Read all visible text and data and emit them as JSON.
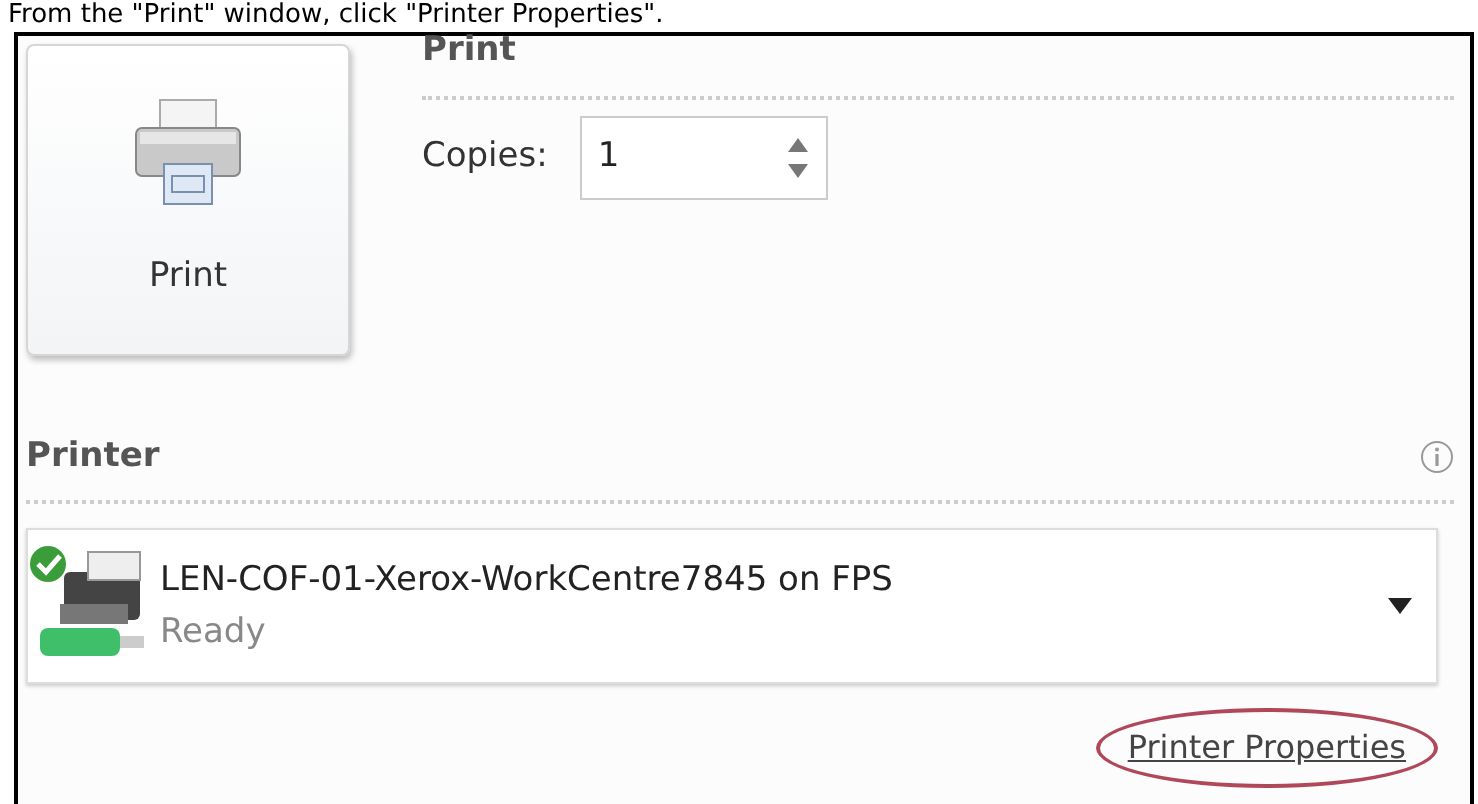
{
  "instruction": "From the \"Print\" window, click \"Printer Properties\".",
  "print_button": {
    "label": "Print"
  },
  "print_section": {
    "title": "Print",
    "copies_label": "Copies:",
    "copies_value": "1"
  },
  "printer_section": {
    "title": "Printer",
    "printer_name": "LEN-COF-01-Xerox-WorkCentre7845 on FPS",
    "printer_status": "Ready",
    "properties_link": "Printer Properties",
    "link_circled": true
  }
}
